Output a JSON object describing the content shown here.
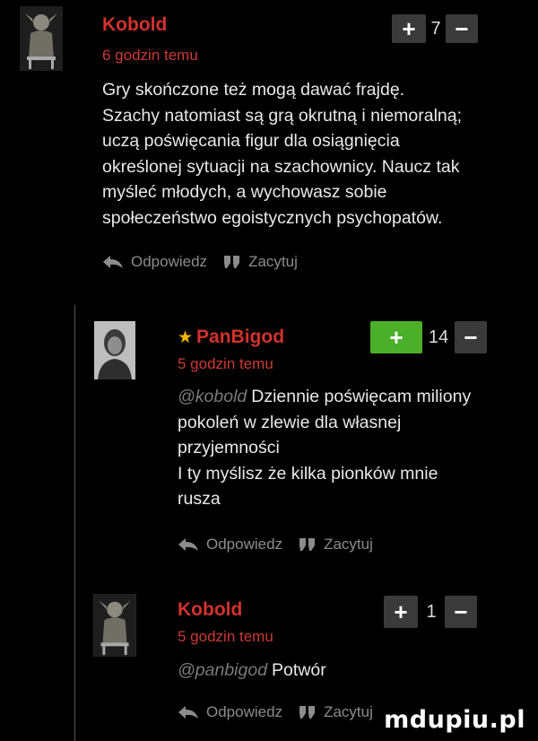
{
  "comments": [
    {
      "author": "Kobold",
      "time": "6 godzin temu",
      "score": "7",
      "plus_label": "+",
      "minus_label": "−",
      "upvoted": false,
      "mention": "",
      "lines": [
        "Gry skończone też mogą dawać frajdę.",
        "Szachy natomiast są grą okrutną i niemoralną;",
        "uczą poświęcania figur dla osiągnięcia",
        "określonej sytuacji na szachownicy. Naucz tak",
        "myśleć młodych, a wychowasz sobie",
        "społeczeństwo egoistycznych psychopatów."
      ],
      "reply_label": "Odpowiedz",
      "quote_label": "Zacytuj",
      "avatar_icon": "goblin-avatar-icon"
    },
    {
      "author": "PanBigod",
      "time": "5 godzin temu",
      "score": "14",
      "plus_label": "+",
      "minus_label": "−",
      "upvoted": true,
      "star": "★",
      "mention": "@kobold",
      "lines": [
        "Dziennie poświęcam miliony",
        "pokoleń w zlewie dla własnej",
        "przyjemności",
        "I ty myślisz że kilka pionków mnie",
        "rusza"
      ],
      "reply_label": "Odpowiedz",
      "quote_label": "Zacytuj",
      "avatar_icon": "portrait-avatar-icon"
    },
    {
      "author": "Kobold",
      "time": "5 godzin temu",
      "score": "1",
      "plus_label": "+",
      "minus_label": "−",
      "upvoted": false,
      "mention": "@panbigod",
      "lines": [
        "Potwór"
      ],
      "reply_label": "Odpowiedz",
      "quote_label": "Zacytuj",
      "avatar_icon": "goblin-avatar-icon"
    }
  ],
  "watermark": "mdupiu.pl",
  "colors": {
    "background": "#000000",
    "author": "#d2322d",
    "time": "#cc3a34",
    "upvote_active": "#4caf2a",
    "vote_button": "#3a3a3a",
    "action_text": "#8c8c8c",
    "mention": "#7a7a7a"
  }
}
